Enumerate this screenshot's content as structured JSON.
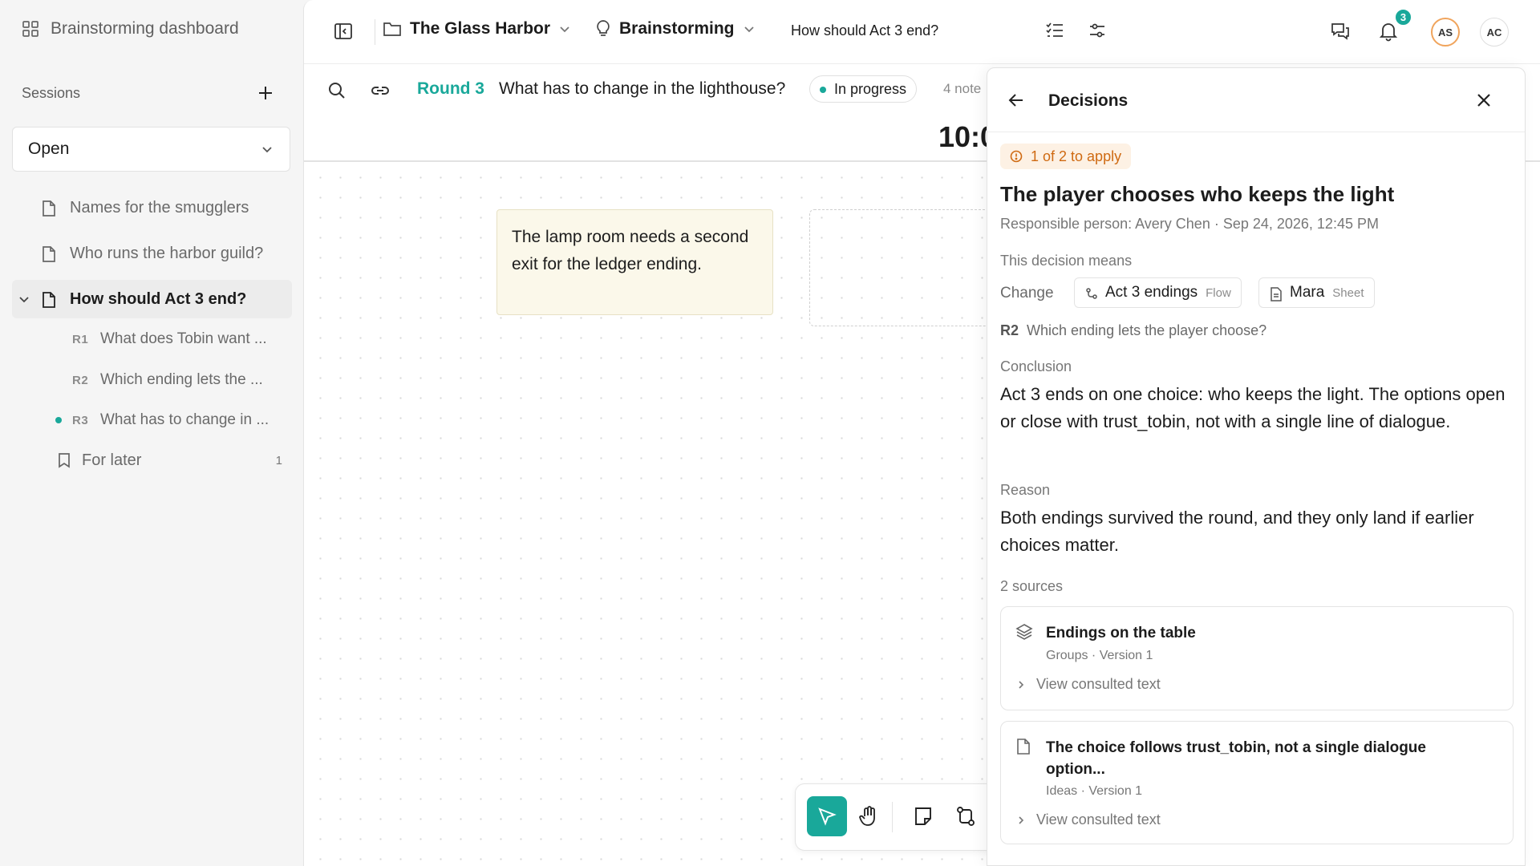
{
  "sidebar": {
    "dashboard_label": "Brainstorming dashboard",
    "sessions_label": "Sessions",
    "filter_value": "Open",
    "items": [
      {
        "label": "Names for the smugglers"
      },
      {
        "label": "Who runs the harbor guild?"
      },
      {
        "label": "How should Act 3 end?"
      }
    ],
    "rounds": [
      {
        "id": "R1",
        "label": "What does Tobin want ..."
      },
      {
        "id": "R2",
        "label": "Which ending lets the ..."
      },
      {
        "id": "R3",
        "label": "What has to change in ..."
      }
    ],
    "later": {
      "label": "For later",
      "count": "1"
    }
  },
  "topbar": {
    "project": "The Glass Harbor",
    "mode": "Brainstorming",
    "question": "How should Act 3 end?",
    "notification_count": "3",
    "avatars": [
      "AS",
      "AC"
    ]
  },
  "round": {
    "label": "Round 3",
    "question": "What has to change in the lighthouse?",
    "status": "In progress",
    "notes_count": "4 note",
    "timer": "10:0"
  },
  "canvas": {
    "sticky_text": "The lamp room needs a second exit for the ledger ending."
  },
  "panel": {
    "title": "Decisions",
    "apply_status": "1 of 2 to apply",
    "decision_title": "The player chooses who keeps the light",
    "meta": "Responsible person: Avery Chen · Sep 24, 2026, 12:45 PM",
    "means_label": "This decision means",
    "change_label": "Change",
    "chips": [
      {
        "name": "Act 3 endings",
        "type": "Flow"
      },
      {
        "name": "Mara",
        "type": "Sheet"
      }
    ],
    "ref_id": "R2",
    "ref_question": "Which ending lets the player choose?",
    "conclusion_label": "Conclusion",
    "conclusion": "Act 3 ends on one choice: who keeps the light. The options open or close with trust_tobin, not with a single line of dialogue.",
    "reason_label": "Reason",
    "reason": "Both endings survived the round, and they only land if earlier choices matter.",
    "sources_label": "2 sources",
    "sources": [
      {
        "title": "Endings on the table",
        "meta": "Groups · Version 1",
        "action": "View consulted text"
      },
      {
        "title": "The choice follows trust_tobin, not a single dialogue option...",
        "meta": "Ideas · Version 1",
        "action": "View consulted text"
      }
    ]
  },
  "colors": {
    "accent": "#19a89a",
    "warning": "#cf6a12",
    "warning_bg": "#fdf1e4"
  }
}
